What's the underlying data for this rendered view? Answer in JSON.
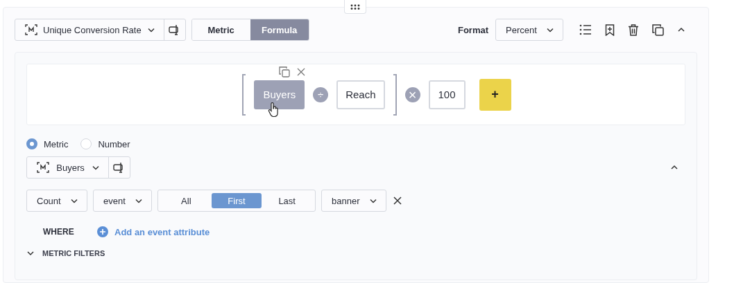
{
  "metric_selector": {
    "label": "Unique Conversion Rate"
  },
  "mode_tabs": [
    {
      "label": "Metric",
      "selected": false
    },
    {
      "label": "Formula",
      "selected": true
    }
  ],
  "format": {
    "label": "Format",
    "value": "Percent"
  },
  "formula": {
    "tokens": [
      {
        "kind": "operand",
        "label": "Buyers",
        "selected": true
      },
      {
        "kind": "operator",
        "symbol": "÷"
      },
      {
        "kind": "operand",
        "label": "Reach",
        "selected": false
      }
    ],
    "multiply_symbol": "×",
    "multiplier": "100",
    "add_label": "+"
  },
  "operand_type": [
    {
      "label": "Metric",
      "selected": true
    },
    {
      "label": "Number",
      "selected": false
    }
  ],
  "metric": {
    "label": "Buyers"
  },
  "aggregation": "Count",
  "entity": "event",
  "occurrence": [
    {
      "label": "All",
      "selected": false
    },
    {
      "label": "First",
      "selected": true
    },
    {
      "label": "Last",
      "selected": false
    }
  ],
  "event": "banner",
  "where": {
    "label": "WHERE",
    "link": "Add an event attribute"
  },
  "metric_filters": {
    "label": "METRIC FILTERS",
    "expanded": false
  }
}
